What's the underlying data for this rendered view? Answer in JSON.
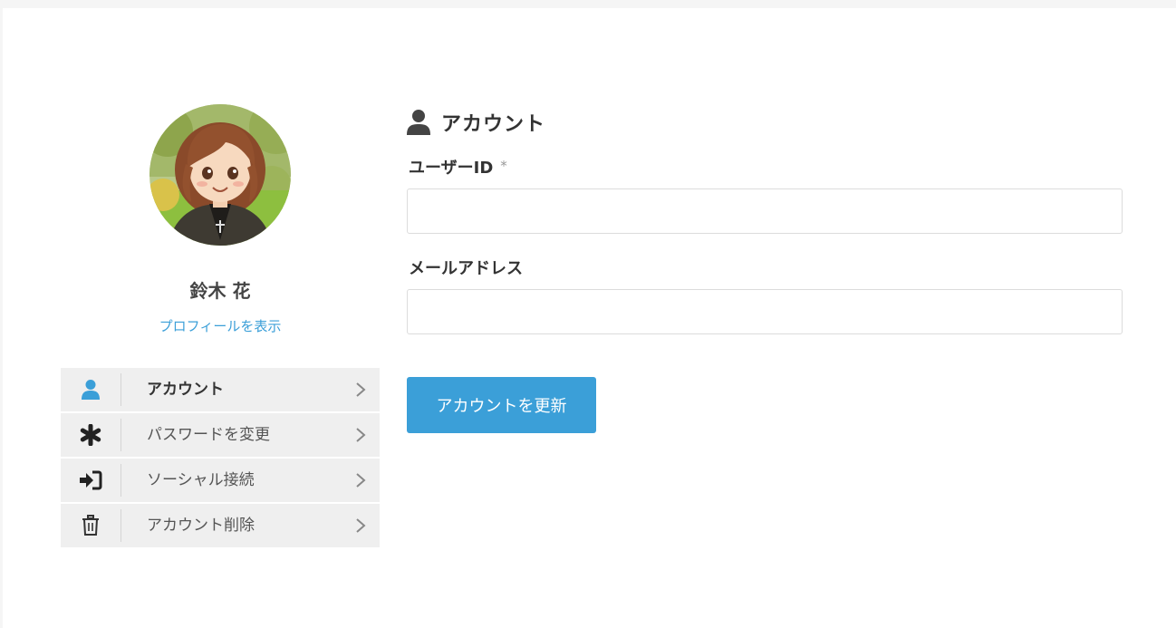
{
  "sidebar": {
    "user_name": "鈴木 花",
    "profile_link": "プロフィールを表示",
    "avatar_icon": "user-avatar-photo",
    "menu": [
      {
        "label": "アカウント",
        "icon": "user-icon",
        "active": true
      },
      {
        "label": "パスワードを変更",
        "icon": "asterisk-icon",
        "active": false
      },
      {
        "label": "ソーシャル接続",
        "icon": "sign-in-icon",
        "active": false
      },
      {
        "label": "アカウント削除",
        "icon": "trash-icon",
        "active": false
      }
    ]
  },
  "main": {
    "section_title": "アカウント",
    "section_icon": "user-icon",
    "fields": {
      "user_id": {
        "label": "ユーザーID",
        "required_mark": "*",
        "value": "",
        "placeholder": ""
      },
      "email": {
        "label": "メールアドレス",
        "value": "",
        "placeholder": ""
      }
    },
    "submit_label": "アカウントを更新"
  },
  "colors": {
    "accent": "#3b9fd8",
    "menu_bg": "#efefef",
    "text": "#333333"
  }
}
